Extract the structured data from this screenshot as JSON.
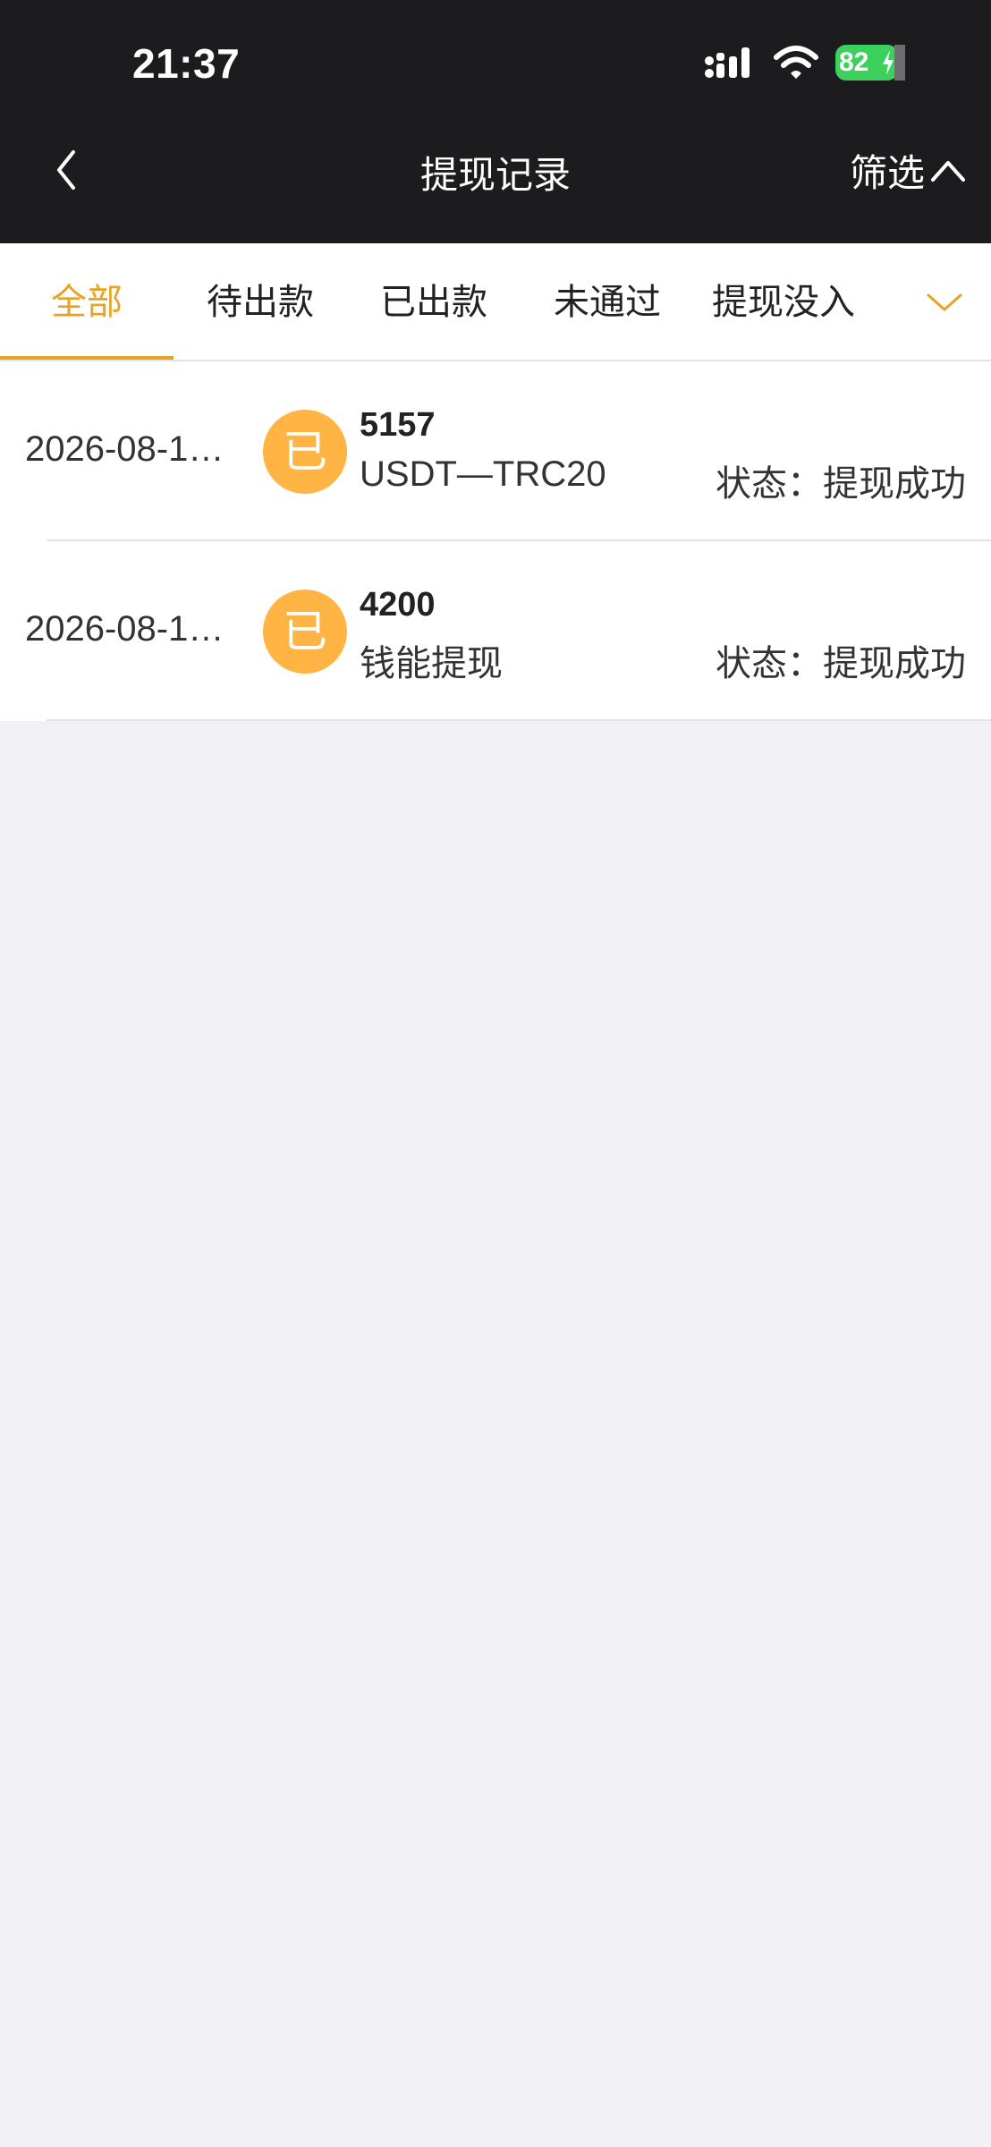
{
  "status_bar": {
    "time": "21:37",
    "battery": "82"
  },
  "nav": {
    "title": "提现记录",
    "filter_label": "筛选"
  },
  "tabs": [
    {
      "label": "全部",
      "active": true
    },
    {
      "label": "待出款",
      "active": false
    },
    {
      "label": "已出款",
      "active": false
    },
    {
      "label": "未通过",
      "active": false
    },
    {
      "label": "提现没入",
      "active": false
    }
  ],
  "records": [
    {
      "date": "2026-08-1…",
      "badge": "已",
      "amount": "5157",
      "method": "USDT—TRC20",
      "status": "状态：提现成功"
    },
    {
      "date": "2026-08-1…",
      "badge": "已",
      "amount": "4200",
      "method": "钱能提现",
      "status": "状态：提现成功"
    }
  ],
  "colors": {
    "accent": "#e8a325",
    "badge": "#ffb443",
    "header_bg": "#1c1c1e",
    "page_bg": "#f0f0f5",
    "battery": "#3bd15c"
  }
}
